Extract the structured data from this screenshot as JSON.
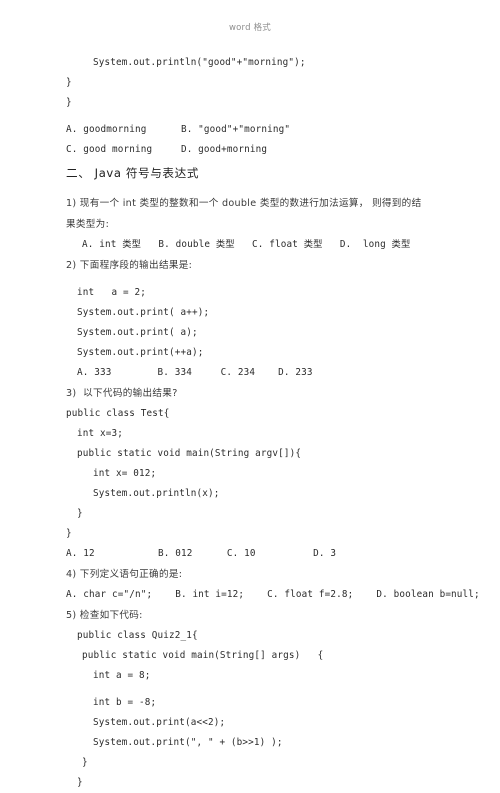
{
  "header": {
    "text": "word 格式"
  },
  "document": {
    "lines": [
      {
        "id": "code-println-goodmorning",
        "style": "ln",
        "indent": "i3",
        "text": "System.out.println(\"good\"+\"morning\");"
      },
      {
        "id": "code-close-brace-1",
        "style": "ln",
        "indent": "i0",
        "text": "}"
      },
      {
        "id": "code-close-brace-2",
        "style": "ln",
        "indent": "i0",
        "text": "}"
      },
      {
        "id": "q-prev-options-ab",
        "style": "ln",
        "indent": "i0",
        "text": "A. goodmorning      B. \"good\"+\"morning\""
      },
      {
        "id": "q-prev-options-cd",
        "style": "ln",
        "indent": "i0",
        "text": "C. good morning     D. good+morning"
      },
      {
        "id": "section-two-title",
        "style": "section-title",
        "indent": "i0",
        "text": "二、 Java 符号与表达式"
      },
      {
        "id": "q1-stem-line1",
        "style": "cn",
        "indent": "i0",
        "text": "1) 现有一个 int 类型的整数和一个 double 类型的数进行加法运算， 则得到的结"
      },
      {
        "id": "q1-stem-line2",
        "style": "cn",
        "indent": "i0",
        "text": "果类型为:"
      },
      {
        "id": "q1-options",
        "style": "ln",
        "indent": "i2",
        "text": "A. int 类型   B. double 类型   C. float 类型   D.  long 类型"
      },
      {
        "id": "q2-stem",
        "style": "cn",
        "indent": "i0",
        "text": "2) 下面程序段的输出结果是:"
      },
      {
        "id": "q2-code-int-a",
        "style": "ln",
        "indent": "i1",
        "text": "int   a = 2;"
      },
      {
        "id": "q2-code-print-aplus",
        "style": "ln",
        "indent": "i1",
        "text": "System.out.print( a++);"
      },
      {
        "id": "q2-code-print-a",
        "style": "ln",
        "indent": "i1",
        "text": "System.out.print( a);"
      },
      {
        "id": "q2-code-print-plusplusa",
        "style": "ln",
        "indent": "i1",
        "text": "System.out.print(++a);"
      },
      {
        "id": "q2-options",
        "style": "ln",
        "indent": "i1",
        "text": "A. 333        B. 334     C. 234    D. 233"
      },
      {
        "id": "q3-stem",
        "style": "cn",
        "indent": "i0",
        "text": "3)  以下代码的输出结果?"
      },
      {
        "id": "q3-code-class-test",
        "style": "ln",
        "indent": "i0",
        "text": "public class Test{"
      },
      {
        "id": "q3-code-int-x3",
        "style": "ln",
        "indent": "i1",
        "text": "int x=3;"
      },
      {
        "id": "q3-code-main",
        "style": "ln",
        "indent": "i1",
        "text": "public static void main(String argv[]){"
      },
      {
        "id": "q3-code-int-x012",
        "style": "ln",
        "indent": "i3",
        "text": "int x= 012;"
      },
      {
        "id": "q3-code-println-x",
        "style": "ln",
        "indent": "i3",
        "text": "System.out.println(x);"
      },
      {
        "id": "q3-code-close-1",
        "style": "ln",
        "indent": "i1",
        "text": "}"
      },
      {
        "id": "q3-code-close-2",
        "style": "ln",
        "indent": "i0",
        "text": "}"
      },
      {
        "id": "q3-options",
        "style": "ln",
        "indent": "i0",
        "text": "A. 12           B. 012      C. 10          D. 3"
      },
      {
        "id": "q4-stem",
        "style": "cn",
        "indent": "i0",
        "text": "4) 下列定义语句正确的是:"
      },
      {
        "id": "q4-options",
        "style": "ln",
        "indent": "i0",
        "text": "A. char c=\"/n\";    B. int i=12;    C. float f=2.8;    D. boolean b=null;"
      },
      {
        "id": "q5-stem",
        "style": "cn",
        "indent": "i0",
        "text": "5) 检查如下代码:"
      },
      {
        "id": "q5-code-class-quiz",
        "style": "ln",
        "indent": "i1",
        "text": "public class Quiz2_1{"
      },
      {
        "id": "q5-code-main",
        "style": "ln",
        "indent": "i2",
        "text": "public static void main(String[] args)   {"
      },
      {
        "id": "q5-code-int-a8",
        "style": "ln",
        "indent": "i3",
        "text": "int a = 8;"
      },
      {
        "id": "q5-code-int-bneg8",
        "style": "ln",
        "indent": "i3",
        "text": "int b = -8;"
      },
      {
        "id": "q5-code-print-shiftleft",
        "style": "ln",
        "indent": "i3",
        "text": "System.out.print(a<<2);"
      },
      {
        "id": "q5-code-print-shiftright",
        "style": "ln",
        "indent": "i3",
        "text": "System.out.print(\", \" + (b>>1) );"
      },
      {
        "id": "q5-code-close-1",
        "style": "ln",
        "indent": "i2",
        "text": "}"
      },
      {
        "id": "q5-code-close-2",
        "style": "ln",
        "indent": "i1",
        "text": "}"
      }
    ]
  }
}
